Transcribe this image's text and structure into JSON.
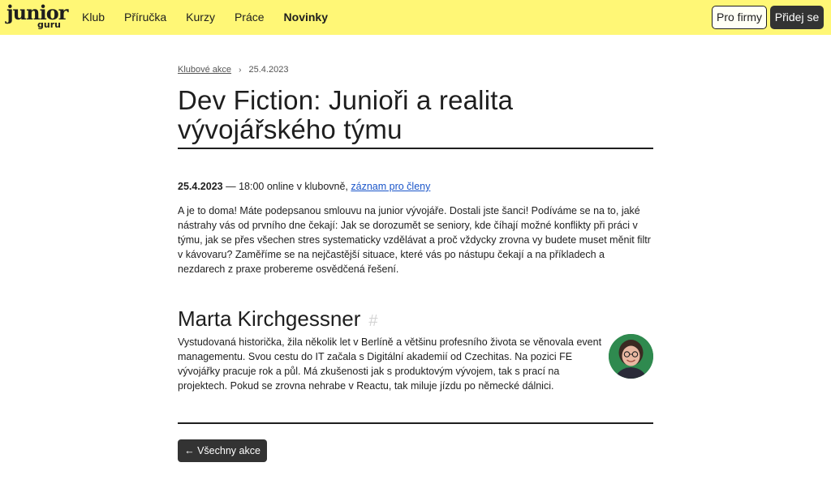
{
  "header": {
    "logo_top": "junior",
    "logo_bottom": "guru",
    "nav": [
      {
        "label": "Klub",
        "active": false
      },
      {
        "label": "Příručka",
        "active": false
      },
      {
        "label": "Kurzy",
        "active": false
      },
      {
        "label": "Práce",
        "active": false
      },
      {
        "label": "Novinky",
        "active": true
      }
    ],
    "firms_label": "Pro firmy",
    "join_label": "Přidej se",
    "bg_color": "#fff776"
  },
  "breadcrumb": {
    "parent": "Klubové akce",
    "separator": "›",
    "current": "25.4.2023"
  },
  "event": {
    "title": "Dev Fiction: Junioři a realita vývojářského týmu",
    "date": "25.4.2023",
    "dash": "—",
    "time_place": "18:00 online v klubovně,",
    "recording_link": "záznam pro členy",
    "description": "A je to doma! Máte podepsanou smlouvu na junior vývojáře. Dostali jste šanci! Podíváme se na to, jaké nástrahy vás od prvního dne čekají: Jak se dorozumět se seniory, kde číhají možné konflikty při práci v týmu, jak se přes všechen stres systematicky vzdělávat a proč vždycky zrovna vy budete muset měnit filtr v kávovaru? Zaměříme se na nejčastější situace, které vás po nástupu čekají a na příkladech a nezdarech z praxe probereme osvědčená řešení."
  },
  "speaker": {
    "name": "Marta Kirchgessner",
    "anchor": "#",
    "bio": "Vystudovaná historička, žila několik let v Berlíně a většinu profesního života se věnovala event managementu. Svou cestu do IT začala s Digitální akademií od Czechitas. Na pozici FE vývojářky pracuje rok a půl. Má zkušenosti jak s produktovým vývojem, tak s prací na projektech. Pokud se zrovna nehrabe v Reactu, tak miluje jízdu po německé dálnici."
  },
  "footer": {
    "back_arrow": "←",
    "back_label": "Všechny akce"
  }
}
